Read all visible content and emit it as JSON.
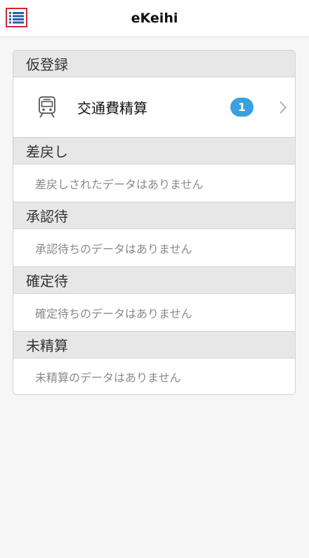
{
  "header": {
    "title": "eKeihi",
    "menu_icon": "list-menu-icon"
  },
  "sections": {
    "provisional": {
      "header": "仮登録",
      "item": {
        "icon": "train-icon",
        "label": "交通費精算",
        "badge_count": "1",
        "chevron_icon": "chevron-right-icon"
      }
    },
    "returned": {
      "header": "差戻し",
      "empty_text": "差戻しされたデータはありません"
    },
    "awaiting_approval": {
      "header": "承認待",
      "empty_text": "承認待ちのデータはありません"
    },
    "awaiting_confirmation": {
      "header": "確定待",
      "empty_text": "確定待ちのデータはありません"
    },
    "unsettled": {
      "header": "未精算",
      "empty_text": "未精算のデータはありません"
    }
  },
  "colors": {
    "menu_border": "#cc2a36",
    "menu_icon": "#2c5fa8",
    "badge": "#3aa0e0",
    "section_header_bg": "#e7e7e7"
  }
}
